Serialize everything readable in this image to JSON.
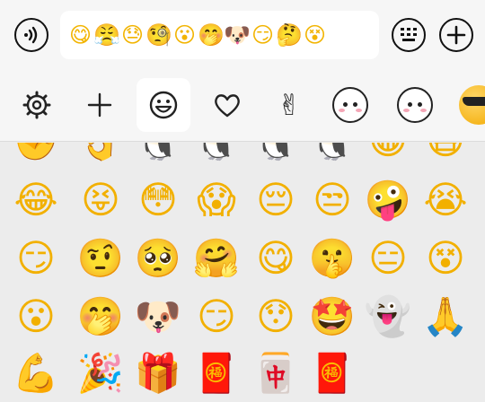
{
  "input": {
    "emojis": [
      "😋",
      "😤",
      "😓",
      "🧐",
      "😮",
      "🤭",
      "🐶",
      "😏",
      "🤔",
      "😵"
    ]
  },
  "tabs": [
    {
      "name": "settings-tab",
      "icon": "gear-icon",
      "glyph": "⚙"
    },
    {
      "name": "add-tab",
      "icon": "plus-icon",
      "glyph": "+"
    },
    {
      "name": "emoji-tab",
      "icon": "smiley-icon",
      "glyph": "☺",
      "active": true
    },
    {
      "name": "favorites-tab",
      "icon": "heart-icon",
      "glyph": "♡"
    },
    {
      "name": "gesture-tab",
      "icon": "victory-hand-icon",
      "glyph": "✌"
    },
    {
      "name": "sticker-pack-1-tab",
      "icon": "blushing-face-sticker-icon"
    },
    {
      "name": "sticker-pack-2-tab",
      "icon": "happy-face-sticker-icon"
    },
    {
      "name": "sticker-pack-3-tab",
      "icon": "sunglasses-face-icon"
    }
  ],
  "grid": {
    "rows": [
      [
        "✊",
        "👌",
        "🐧",
        "🐧",
        "🐧",
        "🐧",
        "😁",
        "😷"
      ],
      [
        "😂",
        "😝",
        "😳",
        "😱",
        "😔",
        "😒",
        "🤪",
        "😭"
      ],
      [
        "😏",
        "🤨",
        "🥺",
        "🤗",
        "😋",
        "🤫",
        "😑",
        "😵"
      ],
      [
        "😮",
        "🤭",
        "🐶",
        "😏",
        "😯",
        "🤩",
        "👻",
        "🙏"
      ],
      [
        "💪",
        "🎉",
        "🎁",
        "🧧",
        "🀄",
        "🧧"
      ]
    ]
  }
}
